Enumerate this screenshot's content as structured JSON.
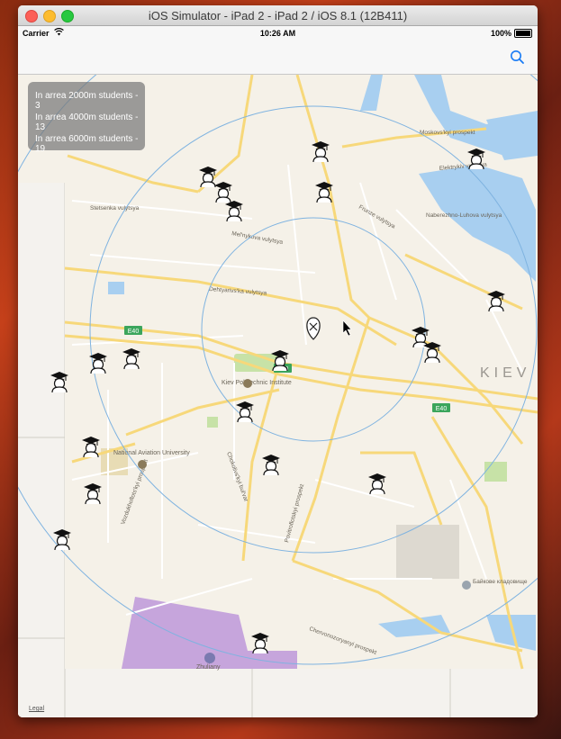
{
  "window": {
    "title": "iOS Simulator - iPad 2 - iPad 2 / iOS 8.1 (12B411)"
  },
  "statusbar": {
    "carrier": "Carrier",
    "time": "10:26 AM",
    "battery": "100%"
  },
  "navbar": {
    "search_icon": "search-icon"
  },
  "info_panel": {
    "lines": [
      "In arrea 2000m students - 3",
      "In arrea 4000m students - 13",
      "In arrea 6000m students - 19"
    ]
  },
  "map": {
    "labels": {
      "stetsenka": "Stetsenka vulytsya",
      "melnykova": "Mel'nykova vulytsya",
      "dehtyarivska": "Dehtyarivs'ka vulytsya",
      "kiev_poly": "Kiev Polytechnic Institute",
      "nat_aviation": "National Aviation University",
      "kiev": "KIEV",
      "e40": "E40",
      "moskovsky": "Moskovs'kyi prospekt",
      "elektrykiv": "Elektrykiv vulytsya",
      "naberezhno": "Naberezhno-Luhova vulytsya",
      "frunze": "Frunze vulytsya",
      "chervonozoryanyi": "Chervonozoryanyi prospekt",
      "baikove": "Байкове кладовище",
      "zhuliany": "Zhuliany",
      "vozdukhoflotskyi": "Vozdukhoflots'kyi prospekt",
      "chokolivskyi": "Chokolivs'kyi bul'var",
      "povitroflotskyi": "Povitroflotskyi prospekt"
    },
    "legal": "Legal"
  },
  "colors": {
    "water": "#a8cff0",
    "road": "#f7d87a",
    "park": "#c7e2a7",
    "airport": "#c6a5dc",
    "circle": "#7fb3e0"
  }
}
